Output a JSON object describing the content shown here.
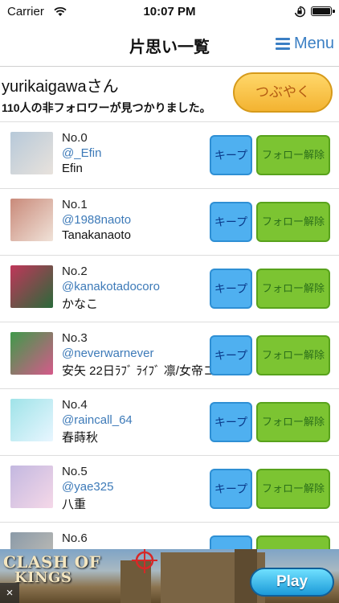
{
  "status_bar": {
    "carrier": "Carrier",
    "time": "10:07 PM"
  },
  "nav": {
    "title": "片思い一覧",
    "menu_label": "Menu"
  },
  "header": {
    "username": "yurikaigawaさん",
    "summary": "110人の非フォロワーが見つかりました。",
    "tweet_button": "つぶやく"
  },
  "buttons": {
    "keep": "キープ",
    "unfollow": "フォロー解除"
  },
  "users": [
    {
      "no": "No.0",
      "handle": "@_Efin",
      "name": "Efin",
      "avatar_colors": [
        "#b7c9d9",
        "#e8e2dc"
      ]
    },
    {
      "no": "No.1",
      "handle": "@1988naoto",
      "name": "Tanakanaoto",
      "avatar_colors": [
        "#c98a7a",
        "#f0e2d8"
      ]
    },
    {
      "no": "No.2",
      "handle": "@kanakotadocoro",
      "name": "かなこ",
      "avatar_colors": [
        "#c0365a",
        "#2a6a3a"
      ]
    },
    {
      "no": "No.3",
      "handle": "@neverwarnever",
      "name": "安矢 22日ﾗﾌﾞ ﾗｲﾌﾞ 凛/女帝コ",
      "avatar_colors": [
        "#3f9a4a",
        "#d55a8a"
      ]
    },
    {
      "no": "No.4",
      "handle": "@raincall_64",
      "name": "春蒔秋",
      "avatar_colors": [
        "#9fe3e8",
        "#e8f6ff"
      ]
    },
    {
      "no": "No.5",
      "handle": "@yae325",
      "name": "八重",
      "avatar_colors": [
        "#c3b8e0",
        "#f5d8e8"
      ]
    },
    {
      "no": "No.6",
      "handle": "",
      "name": "",
      "avatar_colors": [
        "#8a9aa8",
        "#c8c2b8"
      ]
    }
  ],
  "ad": {
    "logo_line1": "CLASH OF",
    "logo_line2": "KINGS",
    "play_button": "Play",
    "close": "×"
  },
  "colors": {
    "link": "#3d7ab8",
    "keep": "#4fb0f0",
    "unfollow": "#7cc432",
    "menu": "#3b7fc4"
  },
  "icons": [
    "wifi-icon",
    "lock-rotation-icon",
    "battery-icon",
    "hamburger-icon",
    "crosshair-icon",
    "close-icon"
  ]
}
